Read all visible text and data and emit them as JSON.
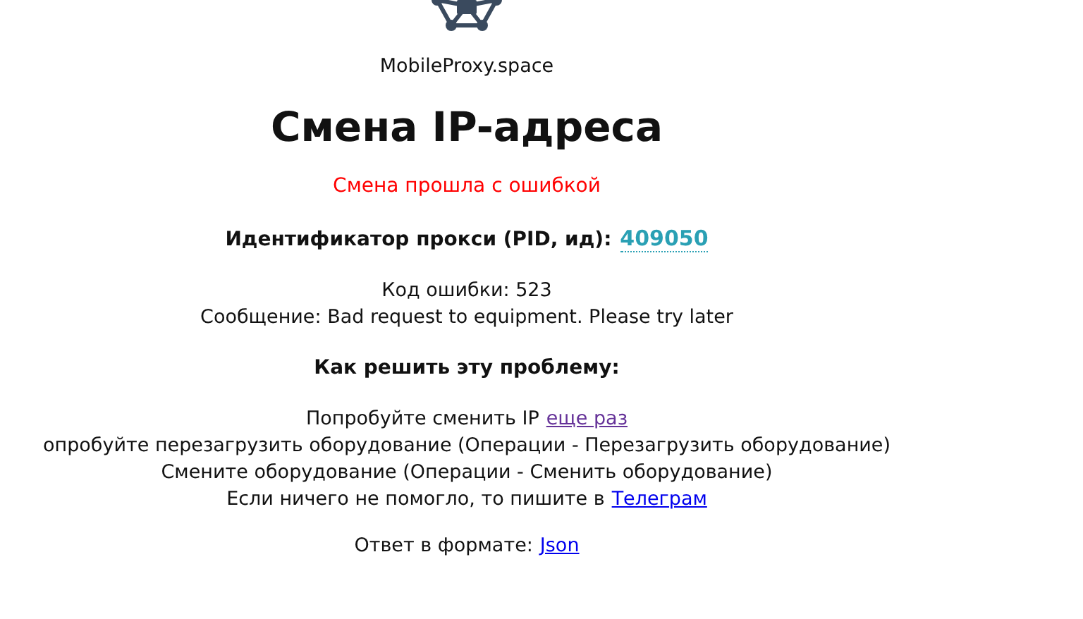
{
  "brand": "MobileProxy.space",
  "title": "Смена IP-адреса",
  "status": "Смена прошла с ошибкой",
  "pid": {
    "label": "Идентификатор прокси (PID, ид):",
    "value": "409050"
  },
  "error": {
    "code": "Код ошибки: 523",
    "message": "Сообщение: Bad request to equipment. Please try later"
  },
  "help": {
    "heading": "Как решить эту проблему:",
    "lines": [
      {
        "text": "Попробуйте сменить IP",
        "link": {
          "text": "еще раз",
          "visited": true
        }
      },
      {
        "text": "опробуйте перезагрузить оборудование (Операции - Перезагрузить оборудование)"
      },
      {
        "text": "Смените оборудование (Операции - Сменить оборудование)"
      },
      {
        "text": "Если ничего не помогло, то пишите в",
        "link": {
          "text": "Телеграм",
          "visited": false
        }
      }
    ]
  },
  "format": {
    "text": "Ответ в формате:",
    "link": {
      "text": "Json",
      "visited": false
    }
  }
}
